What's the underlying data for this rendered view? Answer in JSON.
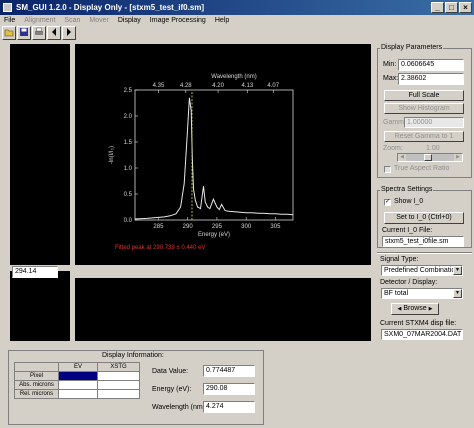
{
  "window": {
    "title": "SM_GUI 1.2.0 - Display Only - [stxm5_test_if0.sm]",
    "min": "_",
    "max": "□",
    "close": "×"
  },
  "menu": [
    "File",
    "Alignment",
    "Scan",
    "Mover",
    "Display",
    "Image Processing",
    "Help"
  ],
  "menu_disabled": [
    false,
    true,
    true,
    true,
    false,
    false,
    false
  ],
  "toolbar_icons": [
    "open-icon",
    "save-icon",
    "print-icon",
    "back-icon",
    "forward-icon"
  ],
  "plot": {
    "top_axis_label": "Wavelength (nm)",
    "top_ticks": [
      "4.35",
      "4.28",
      "4.20",
      "4.13",
      "4.07"
    ],
    "bottom_axis_label": "Energy (eV)",
    "bottom_ticks": [
      "285",
      "290",
      "295",
      "300",
      "305"
    ],
    "y_axis_label": "-ln(I/I₀)",
    "y_ticks": [
      "0.0",
      "0.5",
      "1.0",
      "1.5",
      "2.0",
      "2.5"
    ],
    "annotation": "Fitted peak at 290.739 ± 0.440 eV",
    "line_color": "#e8e8e8",
    "marker_color": "#d8e060"
  },
  "chart_data": {
    "type": "line",
    "xlabel": "Energy (eV)",
    "ylabel": "-ln(I/I₀)",
    "x2label": "Wavelength (nm)",
    "xlim": [
      281,
      308
    ],
    "ylim": [
      0,
      2.5
    ],
    "x": [
      281,
      283,
      285,
      286,
      287,
      288,
      288.8,
      289.4,
      289.9,
      290.3,
      290.6,
      290.8,
      291.0,
      291.3,
      291.7,
      292.2,
      292.7,
      293.0,
      293.4,
      293.8,
      294.4,
      295.0,
      295.4,
      295.8,
      296.4,
      297,
      298,
      299,
      300,
      301,
      302,
      303,
      304,
      305,
      306,
      307,
      308
    ],
    "y": [
      0.02,
      0.03,
      0.05,
      0.06,
      0.08,
      0.12,
      0.25,
      0.7,
      1.6,
      2.35,
      2.1,
      1.2,
      0.6,
      0.38,
      0.25,
      0.22,
      0.65,
      0.35,
      0.25,
      0.22,
      0.4,
      0.25,
      0.2,
      0.3,
      0.18,
      0.17,
      0.16,
      0.15,
      0.14,
      0.14,
      0.13,
      0.13,
      0.12,
      0.12,
      0.11,
      0.11,
      0.1
    ],
    "marker_x": 290.739
  },
  "cursor": {
    "label": "Cursor:",
    "value": "294.14"
  },
  "display_params": {
    "title": "Display Parameters",
    "min_label": "Min:",
    "min_value": "0.0606645",
    "max_label": "Max:",
    "max_value": "2.38602",
    "full_scale": "Full Scale",
    "show_histogram": "Show Histogram",
    "gamma_label": "Gamma:",
    "gamma_value": "1.00000",
    "reset_gamma": "Reset Gamma to 1",
    "zoom_label": "Zoom:",
    "zoom_value": "1.00",
    "true_aspect": "True Aspect Ratio"
  },
  "spectra": {
    "title": "Spectra Settings",
    "show_i0": "Show I_0",
    "set_i0": "Set to I_0 (Ctrl+0)",
    "current_i0_label": "Current I_0 File:",
    "current_i0_file": "stxm5_test_i0file.sm"
  },
  "signal": {
    "type_label": "Signal Type:",
    "type_value": "Predefined Combinations",
    "detector_label": "Detector / Display:",
    "detector_value": "BF total",
    "browse": "Browse",
    "disp_file_label": "Current STXM4 disp file:",
    "disp_file": "SXM0_07MAR2004.DAT"
  },
  "display_info": {
    "title": "Display Information:",
    "col_headers": [
      "EV",
      "XSTG"
    ],
    "rows": [
      "Pixel",
      "Abs. microns",
      "Rel. microns"
    ],
    "data_value_label": "Data Value:",
    "data_value": "0.774487",
    "energy_label": "Energy (eV):",
    "energy": "290.08",
    "wavelength_label": "Wavelength (nm):",
    "wavelength": "4.274"
  }
}
